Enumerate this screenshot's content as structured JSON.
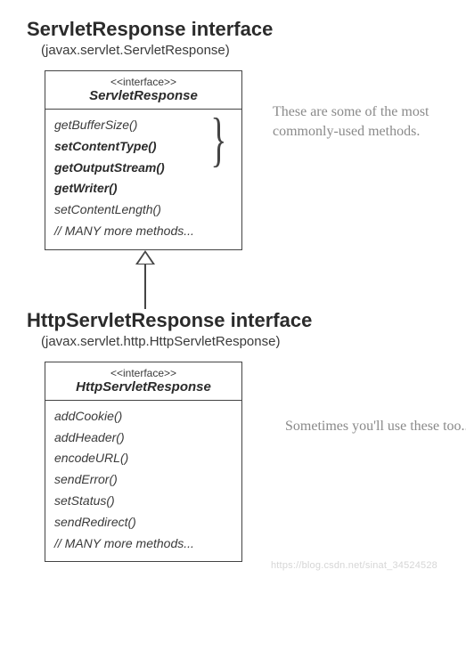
{
  "section1": {
    "title": "ServletResponse interface",
    "subtitle": "(javax.servlet.ServletResponse)",
    "box": {
      "stereotype": "<<interface>>",
      "name": "ServletResponse",
      "methods": [
        {
          "text": "getBufferSize()",
          "bold": false
        },
        {
          "text": "setContentType()",
          "bold": true
        },
        {
          "text": "getOutputStream()",
          "bold": true
        },
        {
          "text": "getWriter()",
          "bold": true
        },
        {
          "text": "setContentLength()",
          "bold": false
        },
        {
          "text": "// MANY more methods...",
          "bold": false
        }
      ]
    },
    "annotation": "These are some of the most commonly-used methods."
  },
  "section2": {
    "title": "HttpServletResponse interface",
    "subtitle": "(javax.servlet.http.HttpServletResponse)",
    "box": {
      "stereotype": "<<interface>>",
      "name": "HttpServletResponse",
      "methods": [
        {
          "text": "addCookie()",
          "bold": false
        },
        {
          "text": "addHeader()",
          "bold": false
        },
        {
          "text": "encodeURL()",
          "bold": false
        },
        {
          "text": "sendError()",
          "bold": false
        },
        {
          "text": "setStatus()",
          "bold": false
        },
        {
          "text": "sendRedirect()",
          "bold": false
        },
        {
          "text": "// MANY more methods...",
          "bold": false
        }
      ]
    },
    "annotation": "Sometimes you'll use these too..."
  },
  "watermark": "https://blog.csdn.net/sinat_34524528"
}
